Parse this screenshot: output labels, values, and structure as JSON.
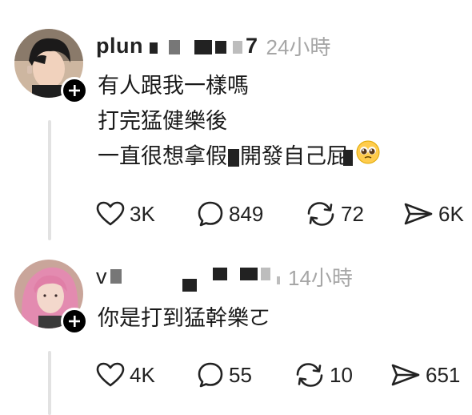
{
  "posts": [
    {
      "username_visible": "plun",
      "username_tail": "7",
      "time": "24小時",
      "lines": [
        "有人跟我一樣嗎",
        "打完猛健樂後",
        "一直很想拿假",
        "開發自己屁"
      ],
      "emoji": "pleading-face",
      "stats": {
        "likes": "3K",
        "comments": "849",
        "reposts": "72",
        "shares": "6K"
      }
    },
    {
      "username_visible": "v",
      "username_tail": "",
      "time": "14小時",
      "lines": [
        "你是打到猛幹樂ㄛ"
      ],
      "stats": {
        "likes": "4K",
        "comments": "55",
        "reposts": "10",
        "shares": "651"
      }
    }
  ],
  "icons": {
    "like": "heart-icon",
    "comment": "comment-bubble-icon",
    "repost": "repost-arrows-icon",
    "share": "send-icon",
    "follow": "plus-icon"
  },
  "colors": {
    "text": "#111111",
    "muted": "#a6a6a6",
    "thread_line": "#e2e2e2",
    "follow_button": "#000000"
  }
}
